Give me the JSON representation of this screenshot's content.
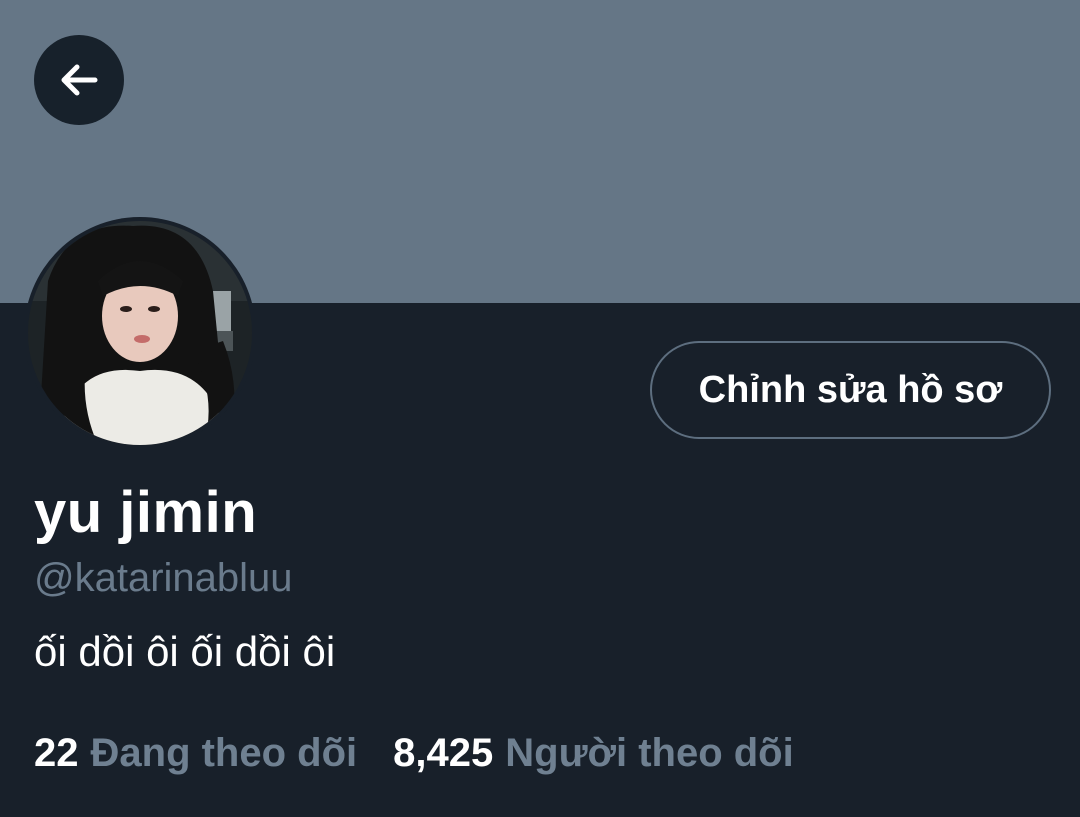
{
  "header": {
    "back_label": "Back"
  },
  "profile": {
    "display_name": "yu jimin",
    "handle": "@katarinabluu",
    "bio": "ối dồi ôi ối dồi ôi",
    "edit_button_label": "Chỉnh sửa hồ sơ",
    "avatar_alt": "profile photo"
  },
  "stats": {
    "following_count": "22",
    "following_label": "Đang theo dõi",
    "followers_count": "8,425",
    "followers_label": "Người theo dõi"
  },
  "colors": {
    "banner": "#657686",
    "background": "#18202a",
    "secondary_text": "#6a7b8c",
    "button_border": "#5d6e7f"
  },
  "icons": {
    "back": "arrow-left-icon"
  }
}
